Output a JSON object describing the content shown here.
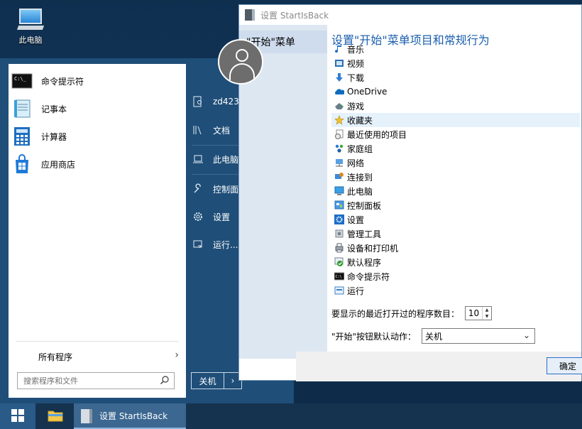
{
  "desktop": {
    "icon_label": "此电脑"
  },
  "start_menu": {
    "programs": [
      {
        "label": "命令提示符",
        "icon": "cmd-icon"
      },
      {
        "label": "记事本",
        "icon": "notepad-icon"
      },
      {
        "label": "计算器",
        "icon": "calculator-icon"
      },
      {
        "label": "应用商店",
        "icon": "store-icon"
      }
    ],
    "all_programs": "所有程序",
    "search_placeholder": "搜索程序和文件",
    "right_links": [
      {
        "label": "zd423",
        "icon": "user-folder-icon"
      },
      {
        "label": "文档",
        "icon": "documents-icon"
      },
      {
        "label": "此电脑",
        "icon": "computer-icon"
      },
      {
        "label": "控制面板",
        "icon": "control-panel-icon"
      },
      {
        "label": "设置",
        "icon": "gear-icon"
      },
      {
        "label": "运行...",
        "icon": "run-icon"
      }
    ],
    "power_label": "关机",
    "power_arrow": "›"
  },
  "settings_window": {
    "title": "设置 StartIsBack",
    "nav_selected": "\"开始\"菜单",
    "heading": "设置\"开始\"菜单项目和常规行为",
    "items": [
      {
        "label": "音乐",
        "icon": "music-icon"
      },
      {
        "label": "视频",
        "icon": "video-icon"
      },
      {
        "label": "下载",
        "icon": "download-icon"
      },
      {
        "label": "OneDrive",
        "icon": "onedrive-icon"
      },
      {
        "label": "游戏",
        "icon": "games-icon"
      },
      {
        "label": "收藏夹",
        "icon": "favorites-icon"
      },
      {
        "label": "最近使用的项目",
        "icon": "recent-items-icon"
      },
      {
        "label": "家庭组",
        "icon": "homegroup-icon"
      },
      {
        "label": "网络",
        "icon": "network-icon"
      },
      {
        "label": "连接到",
        "icon": "connect-to-icon"
      },
      {
        "label": "此电脑",
        "icon": "this-pc-icon"
      },
      {
        "label": "控制面板",
        "icon": "control-panel-icon"
      },
      {
        "label": "设置",
        "icon": "settings-icon"
      },
      {
        "label": "管理工具",
        "icon": "admin-tools-icon"
      },
      {
        "label": "设备和打印机",
        "icon": "devices-printers-icon"
      },
      {
        "label": "默认程序",
        "icon": "default-programs-icon"
      },
      {
        "label": "命令提示符",
        "icon": "cmd-icon"
      },
      {
        "label": "运行",
        "icon": "run-icon"
      }
    ],
    "highlighted_item": "收藏夹",
    "recent_count_label": "要显示的最近打开过的程序数目：",
    "recent_count_value": "10",
    "start_button_action_label": "\"开始\"按钮默认动作：",
    "start_button_action_value": "关机",
    "ok_label": "确定"
  },
  "taskbar": {
    "task_label": "设置 StartIsBack"
  },
  "colors": {
    "start_menu_bg": "#1f4e78",
    "heading_blue": "#1b5fae",
    "nav_bg": "#dde7f1",
    "highlight": "#e5f1fb"
  }
}
